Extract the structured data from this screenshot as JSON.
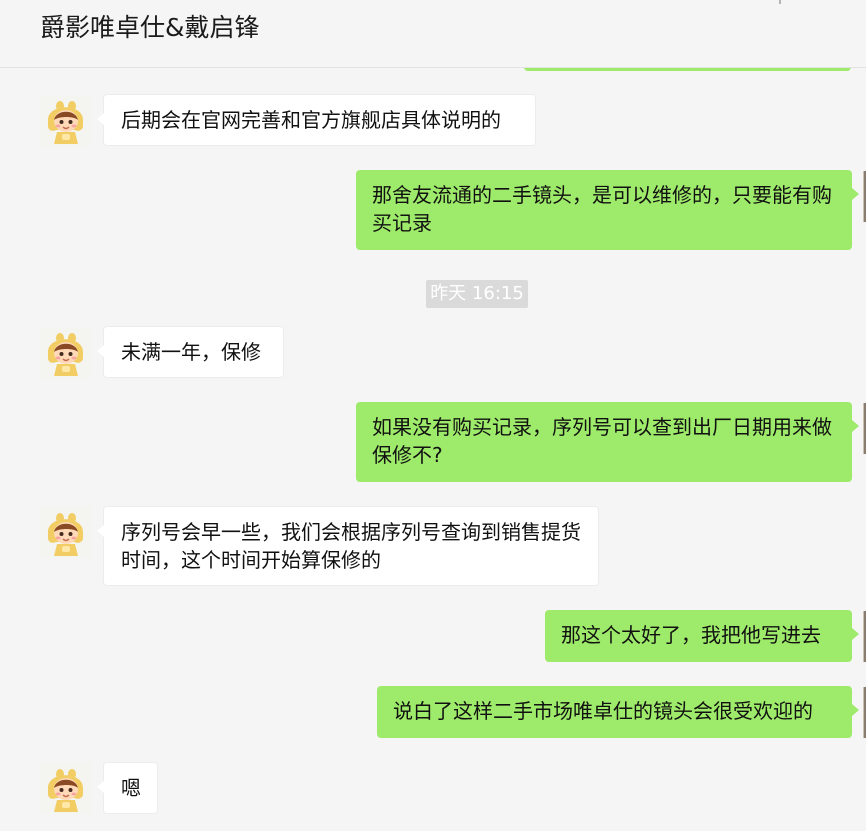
{
  "chat": {
    "title": "爵影唯卓仕&戴启锋"
  },
  "messages": [
    {
      "side": "in",
      "text": "后期会在官网完善和官方旗舰店具体说明的"
    },
    {
      "side": "out",
      "text": "那舍友流通的二手镜头，是可以维修的，只要能有购买记录"
    },
    {
      "side": "in",
      "text": "未满一年，保修"
    },
    {
      "side": "out",
      "text": "如果没有购买记录，序列号可以查到出厂日期用来做保修不?"
    },
    {
      "side": "in",
      "text": "序列号会早一些，我们会根据序列号查询到销售提货时间，这个时间开始算保修的"
    },
    {
      "side": "out",
      "text": "那这个太好了，我把他写进去"
    },
    {
      "side": "out",
      "text": "说白了这样二手市场唯卓仕的镜头会很受欢迎的"
    },
    {
      "side": "in",
      "text": "嗯"
    }
  ],
  "timestamp": "昨天 16:15",
  "colors": {
    "background": "#f5f5f5",
    "outgoing_bubble": "#9eea6a",
    "incoming_bubble": "#ffffff",
    "timestamp_pill": "#dadada"
  },
  "icons": {
    "contact_avatar": "cartoon-child-in-yellow-hood-avatar",
    "self_avatar": "partial-user-avatar"
  }
}
